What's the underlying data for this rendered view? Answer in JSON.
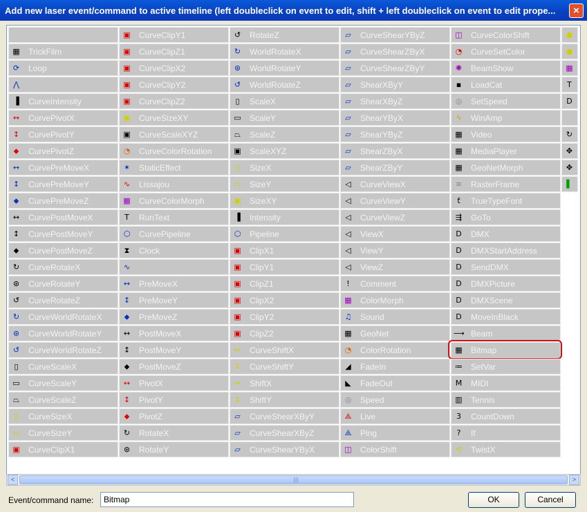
{
  "window": {
    "title": "Add new laser event/command to active timeline (left doubleclick on event to edit, shift + left doubleclick on event to edit prope...",
    "close_symbol": "×"
  },
  "columns": [
    [
      {
        "label": "",
        "icon": "blank"
      },
      {
        "label": "TrickFilm",
        "icon": "film-icon"
      },
      {
        "label": "Loop",
        "icon": "loop-icon"
      },
      {
        "label": "",
        "icon": "curve-icon"
      },
      {
        "label": "CurveIntensity",
        "icon": "intensity-icon"
      },
      {
        "label": "CurvePivotX",
        "icon": "pivot-x-icon"
      },
      {
        "label": "CurvePivotY",
        "icon": "pivot-y-icon"
      },
      {
        "label": "CurvePivotZ",
        "icon": "pivot-z-icon"
      },
      {
        "label": "CurvePreMoveX",
        "icon": "premove-x-icon"
      },
      {
        "label": "CurvePreMoveY",
        "icon": "premove-y-icon"
      },
      {
        "label": "CurvePreMoveZ",
        "icon": "premove-z-icon"
      },
      {
        "label": "CurvePostMoveX",
        "icon": "postmove-x-icon"
      },
      {
        "label": "CurvePostMoveY",
        "icon": "postmove-y-icon"
      },
      {
        "label": "CurvePostMoveZ",
        "icon": "postmove-z-icon"
      },
      {
        "label": "CurveRotateX",
        "icon": "rotate-x-icon"
      },
      {
        "label": "CurveRotateY",
        "icon": "rotate-y-icon"
      },
      {
        "label": "CurveRotateZ",
        "icon": "rotate-z-icon"
      },
      {
        "label": "CurveWorldRotateX",
        "icon": "world-rotate-x-icon"
      },
      {
        "label": "CurveWorldRotateY",
        "icon": "world-rotate-y-icon"
      },
      {
        "label": "CurveWorldRotateZ",
        "icon": "world-rotate-z-icon"
      },
      {
        "label": "CurveScaleX",
        "icon": "scale-x-icon"
      },
      {
        "label": "CurveScaleY",
        "icon": "scale-y-icon"
      },
      {
        "label": "CurveScaleZ",
        "icon": "scale-z-icon"
      },
      {
        "label": "CurveSizeX",
        "icon": "size-x-icon"
      },
      {
        "label": "CurveSizeY",
        "icon": "size-y-icon"
      },
      {
        "label": "CurveClipX1",
        "icon": "clip-icon"
      }
    ],
    [
      {
        "label": "CurveClipY1",
        "icon": "clip-icon"
      },
      {
        "label": "CurveClipZ1",
        "icon": "clip-icon"
      },
      {
        "label": "CurveClipX2",
        "icon": "clip-icon"
      },
      {
        "label": "CurveClipY2",
        "icon": "clip-icon"
      },
      {
        "label": "CurveClipZ2",
        "icon": "clip-icon"
      },
      {
        "label": "CurveSizeXY",
        "icon": "size-icon"
      },
      {
        "label": "CurveScaleXYZ",
        "icon": "scale-icon"
      },
      {
        "label": "CurveColorRotation",
        "icon": "color-rotation-icon"
      },
      {
        "label": "StaticEffect",
        "icon": "static-effect-icon"
      },
      {
        "label": "Lissajou",
        "icon": "lissajou-icon"
      },
      {
        "label": "CurveColorMorph",
        "icon": "color-morph-icon"
      },
      {
        "label": "RunText",
        "icon": "text-icon"
      },
      {
        "label": "CurvePipeline",
        "icon": "pipeline-icon"
      },
      {
        "label": "Clock",
        "icon": "hourglass-icon"
      },
      {
        "label": "",
        "icon": "wave-icon"
      },
      {
        "label": "PreMoveX",
        "icon": "premove-x-icon"
      },
      {
        "label": "PreMoveY",
        "icon": "premove-y-icon"
      },
      {
        "label": "PreMoveZ",
        "icon": "premove-z-icon"
      },
      {
        "label": "PostMoveX",
        "icon": "postmove-x-icon"
      },
      {
        "label": "PostMoveY",
        "icon": "postmove-y-icon"
      },
      {
        "label": "PostMoveZ",
        "icon": "postmove-z-icon"
      },
      {
        "label": "PivotX",
        "icon": "pivot-x-icon"
      },
      {
        "label": "PivotY",
        "icon": "pivot-y-icon"
      },
      {
        "label": "PivotZ",
        "icon": "pivot-z-icon"
      },
      {
        "label": "RotateX",
        "icon": "rotate-x-icon"
      },
      {
        "label": "RotateY",
        "icon": "rotate-y-icon"
      }
    ],
    [
      {
        "label": "RotateZ",
        "icon": "rotate-z-icon"
      },
      {
        "label": "WorldRotateX",
        "icon": "world-rotate-x-icon"
      },
      {
        "label": "WorldRotateY",
        "icon": "world-rotate-y-icon"
      },
      {
        "label": "WorldRotateZ",
        "icon": "world-rotate-z-icon"
      },
      {
        "label": "ScaleX",
        "icon": "scale-x-icon"
      },
      {
        "label": "ScaleY",
        "icon": "scale-y-icon"
      },
      {
        "label": "ScaleZ",
        "icon": "scale-z-icon"
      },
      {
        "label": "ScaleXYZ",
        "icon": "scale-icon"
      },
      {
        "label": "SizeX",
        "icon": "size-x-icon"
      },
      {
        "label": "SizeY",
        "icon": "size-y-icon"
      },
      {
        "label": "SizeXY",
        "icon": "size-icon"
      },
      {
        "label": "Intensity",
        "icon": "intensity-icon"
      },
      {
        "label": "Pipeline",
        "icon": "pipeline-icon"
      },
      {
        "label": "ClipX1",
        "icon": "clip-icon"
      },
      {
        "label": "ClipY1",
        "icon": "clip-icon"
      },
      {
        "label": "ClipZ1",
        "icon": "clip-icon"
      },
      {
        "label": "ClipX2",
        "icon": "clip-icon"
      },
      {
        "label": "ClipY2",
        "icon": "clip-icon"
      },
      {
        "label": "ClipZ2",
        "icon": "clip-icon"
      },
      {
        "label": "CurveShiftX",
        "icon": "shift-x-icon"
      },
      {
        "label": "CurveShiftY",
        "icon": "shift-y-icon"
      },
      {
        "label": "ShiftX",
        "icon": "shift-x-icon"
      },
      {
        "label": "ShiftY",
        "icon": "shift-y-icon"
      },
      {
        "label": "CurveShearXByY",
        "icon": "shear-icon"
      },
      {
        "label": "CurveShearXByZ",
        "icon": "shear-icon"
      },
      {
        "label": "CurveShearYByX",
        "icon": "shear-icon"
      }
    ],
    [
      {
        "label": "CurveShearYByZ",
        "icon": "shear-icon"
      },
      {
        "label": "CurveShearZByX",
        "icon": "shear-icon"
      },
      {
        "label": "CurveShearZByY",
        "icon": "shear-icon"
      },
      {
        "label": "ShearXByY",
        "icon": "shear-icon"
      },
      {
        "label": "ShearXByZ",
        "icon": "shear-icon"
      },
      {
        "label": "ShearYByX",
        "icon": "shear-icon"
      },
      {
        "label": "ShearYByZ",
        "icon": "shear-icon"
      },
      {
        "label": "ShearZByX",
        "icon": "shear-icon"
      },
      {
        "label": "ShearZByY",
        "icon": "shear-icon"
      },
      {
        "label": "CurveViewX",
        "icon": "view-x-icon"
      },
      {
        "label": "CurveViewY",
        "icon": "view-y-icon"
      },
      {
        "label": "CurveViewZ",
        "icon": "view-z-icon"
      },
      {
        "label": "ViewX",
        "icon": "view-x-icon"
      },
      {
        "label": "ViewY",
        "icon": "view-y-icon"
      },
      {
        "label": "ViewZ",
        "icon": "view-z-icon"
      },
      {
        "label": "Comment",
        "icon": "comment-icon"
      },
      {
        "label": "ColorMorph",
        "icon": "color-morph-icon"
      },
      {
        "label": "Sound",
        "icon": "sound-icon"
      },
      {
        "label": "GeoNet",
        "icon": "geonet-icon"
      },
      {
        "label": "ColorRotation",
        "icon": "color-rotation-icon"
      },
      {
        "label": "FadeIn",
        "icon": "fade-in-icon"
      },
      {
        "label": "FadeOut",
        "icon": "fade-out-icon"
      },
      {
        "label": "Speed",
        "icon": "speed-icon"
      },
      {
        "label": "Live",
        "icon": "live-icon"
      },
      {
        "label": "Ping",
        "icon": "ping-icon"
      },
      {
        "label": "ColorShift",
        "icon": "color-shift-icon"
      }
    ],
    [
      {
        "label": "CurveColorShift",
        "icon": "color-shift-icon"
      },
      {
        "label": "CurveSetColor",
        "icon": "set-color-icon"
      },
      {
        "label": "BeamShow",
        "icon": "beam-show-icon"
      },
      {
        "label": "LoadCat",
        "icon": "floppy-icon"
      },
      {
        "label": "SetSpeed",
        "icon": "speed-icon"
      },
      {
        "label": "WinAmp",
        "icon": "winamp-icon"
      },
      {
        "label": "Video",
        "icon": "video-icon"
      },
      {
        "label": "MediaPlayer",
        "icon": "video-icon"
      },
      {
        "label": "GeoNetMorph",
        "icon": "geonet-icon"
      },
      {
        "label": "RasterFrame",
        "icon": "raster-icon"
      },
      {
        "label": "TrueTypeFont",
        "icon": "ttf-icon"
      },
      {
        "label": "GoTo",
        "icon": "goto-icon"
      },
      {
        "label": "DMX",
        "icon": "dmx-icon"
      },
      {
        "label": "DMXStartAddress",
        "icon": "dmx-icon"
      },
      {
        "label": "SendDMX",
        "icon": "dmx-icon"
      },
      {
        "label": "DMXPicture",
        "icon": "dmx-icon"
      },
      {
        "label": "DMXScene",
        "icon": "dmx-icon"
      },
      {
        "label": "MoveInBlack",
        "icon": "dmx-icon"
      },
      {
        "label": "Beam",
        "icon": "beam-icon"
      },
      {
        "label": "Bitmap",
        "icon": "bitmap-icon"
      },
      {
        "label": "SetVar",
        "icon": "setvar-icon"
      },
      {
        "label": "MIDI",
        "icon": "midi-icon"
      },
      {
        "label": "Tennis",
        "icon": "tennis-icon"
      },
      {
        "label": "CountDown",
        "icon": "countdown-icon"
      },
      {
        "label": "If",
        "icon": "if-icon"
      },
      {
        "label": "TwistX",
        "icon": "twist-icon"
      }
    ],
    [
      {
        "label": "",
        "icon": "color-dot-icon"
      },
      {
        "label": "",
        "icon": "color-dot-icon"
      },
      {
        "label": "",
        "icon": "rgb-icon"
      },
      {
        "label": "",
        "icon": "ttl-icon"
      },
      {
        "label": "",
        "icon": "dmx-icon"
      },
      {
        "label": "",
        "icon": "blank"
      },
      {
        "label": "",
        "icon": "xyz-rotate-icon"
      },
      {
        "label": "",
        "icon": "xyz-move-icon"
      },
      {
        "label": "",
        "icon": "xyz-move-icon"
      },
      {
        "label": "",
        "icon": "rgb-bars-icon"
      }
    ]
  ],
  "selected": "Bitmap",
  "name_label": "Event/command name:",
  "name_value": "Bitmap",
  "ok_label": "OK",
  "cancel_label": "Cancel",
  "scroll_left": "<",
  "scroll_right": ">",
  "thumb_grip": "|||",
  "highlight_color": "#d01010"
}
